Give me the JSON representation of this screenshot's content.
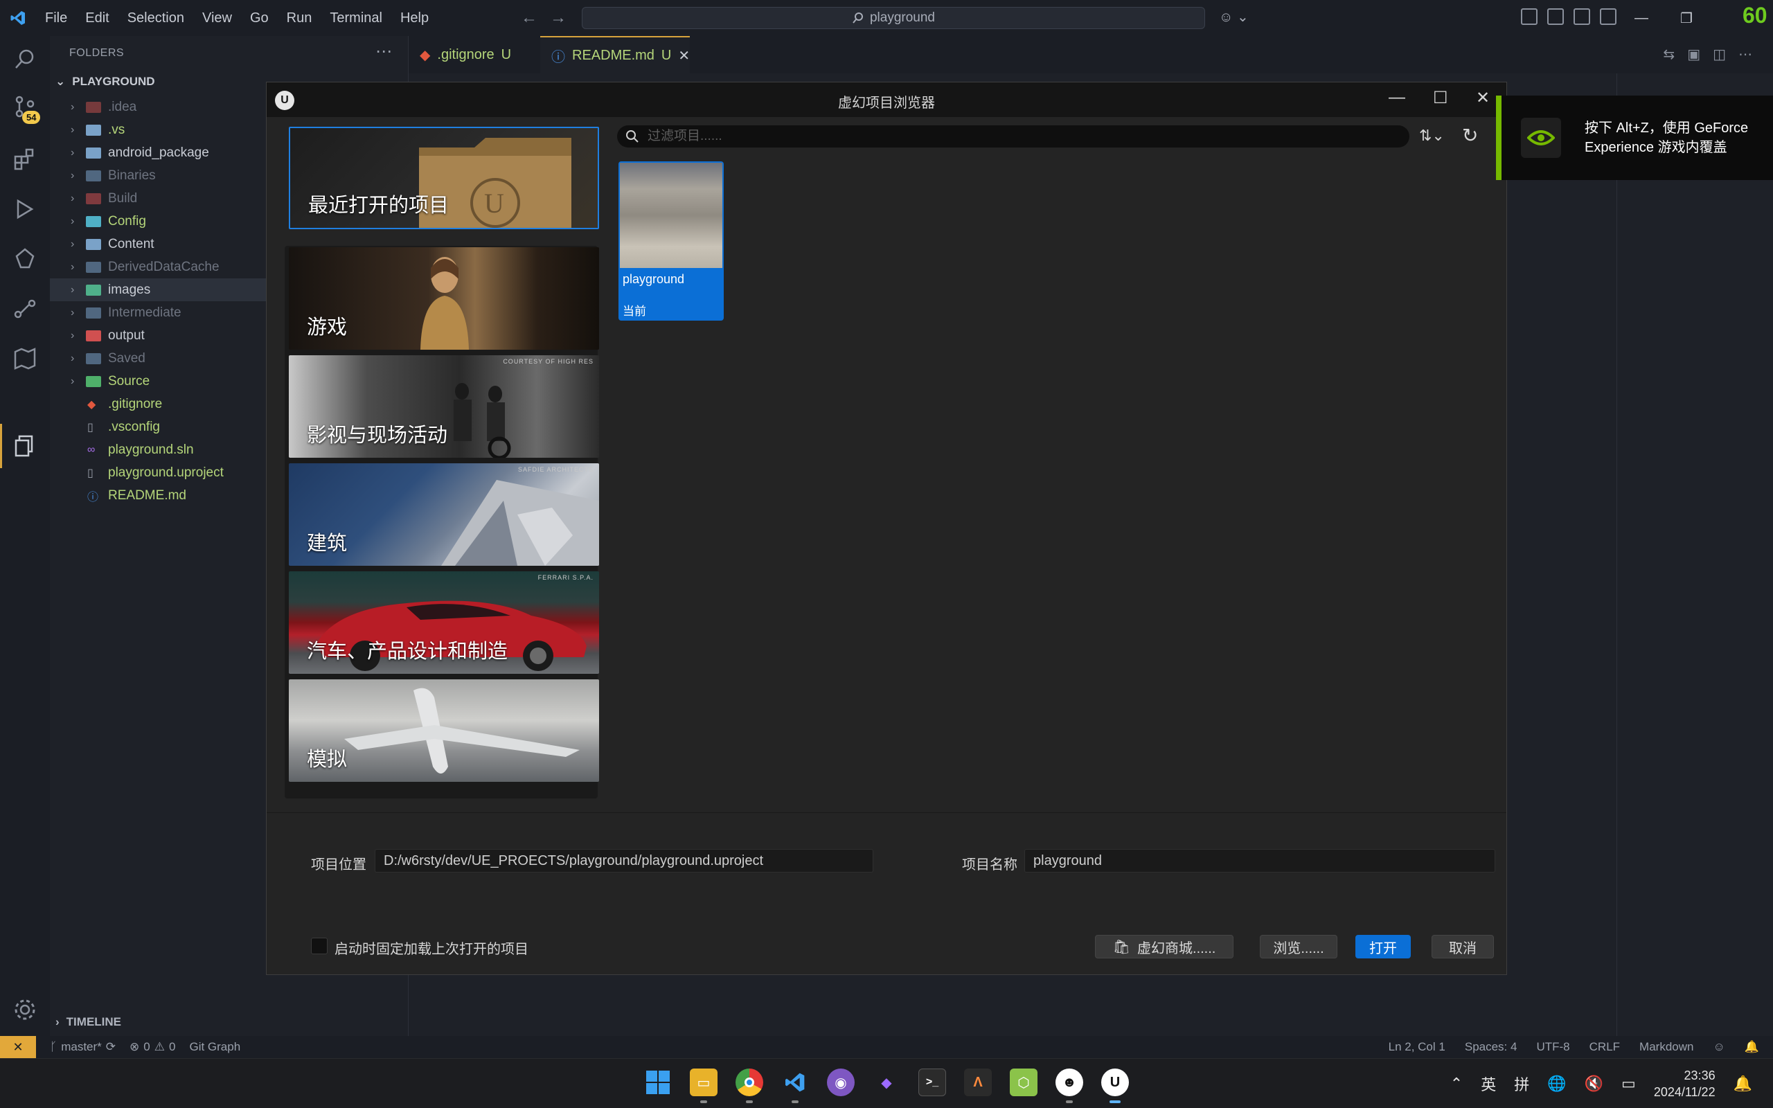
{
  "titlebar": {
    "menu": [
      "File",
      "Edit",
      "Selection",
      "View",
      "Go",
      "Run",
      "Terminal",
      "Help"
    ],
    "search_text": "playground",
    "fps": "60"
  },
  "activity": {
    "scm_badge": "54"
  },
  "sidebar": {
    "header": "FOLDERS",
    "root": "PLAYGROUND",
    "items": [
      {
        "label": ".idea",
        "type": "folder",
        "color": "#6e7480",
        "icon_color": "#c0504d",
        "muted": true
      },
      {
        "label": ".vs",
        "type": "folder",
        "color": "#b5d67a",
        "icon_color": "#7aa2c8",
        "muted": false
      },
      {
        "label": "android_package",
        "type": "folder",
        "color": "#c8ccd4",
        "icon_color": "#7aa2c8",
        "muted": false
      },
      {
        "label": "Binaries",
        "type": "folder",
        "color": "#6e7480",
        "icon_color": "#7aa2c8",
        "muted": true
      },
      {
        "label": "Build",
        "type": "folder",
        "color": "#6e7480",
        "icon_color": "#d05050",
        "muted": true
      },
      {
        "label": "Config",
        "type": "folder",
        "color": "#b5d67a",
        "icon_color": "#4fb0c6",
        "muted": false
      },
      {
        "label": "Content",
        "type": "folder",
        "color": "#c8ccd4",
        "icon_color": "#7aa2c8",
        "muted": false
      },
      {
        "label": "DerivedDataCache",
        "type": "folder",
        "color": "#6e7480",
        "icon_color": "#7aa2c8",
        "muted": true
      },
      {
        "label": "images",
        "type": "folder",
        "color": "#c8ccd4",
        "icon_color": "#4fb08a",
        "muted": false
      },
      {
        "label": "Intermediate",
        "type": "folder",
        "color": "#6e7480",
        "icon_color": "#7aa2c8",
        "muted": true
      },
      {
        "label": "output",
        "type": "folder",
        "color": "#c8ccd4",
        "icon_color": "#d05050",
        "muted": false
      },
      {
        "label": "Saved",
        "type": "folder",
        "color": "#6e7480",
        "icon_color": "#7aa2c8",
        "muted": true
      },
      {
        "label": "Source",
        "type": "folder",
        "color": "#b5d67a",
        "icon_color": "#4fb06a",
        "muted": false
      },
      {
        "label": ".gitignore",
        "type": "file",
        "color": "#b5d67a",
        "icon_color": "#e2583e",
        "glyph": "◆"
      },
      {
        "label": ".vsconfig",
        "type": "file",
        "color": "#b5d67a",
        "icon_color": "#9aa0ab",
        "glyph": "▯"
      },
      {
        "label": "playground.sln",
        "type": "file",
        "color": "#b5d67a",
        "icon_color": "#a66ee8",
        "glyph": "∞"
      },
      {
        "label": "playground.uproject",
        "type": "file",
        "color": "#b5d67a",
        "icon_color": "#9aa0ab",
        "glyph": "▯"
      },
      {
        "label": "README.md",
        "type": "file",
        "color": "#b5d67a",
        "icon_color": "#4a90e2",
        "glyph": "ⓘ"
      }
    ],
    "timeline": "TIMELINE"
  },
  "tabs": [
    {
      "label": ".gitignore",
      "status": "U",
      "icon_color": "#e2583e"
    },
    {
      "label": "README.md",
      "status": "U",
      "icon_color": "#4a90e2"
    }
  ],
  "statusbar": {
    "branch": "master*",
    "problems": "0",
    "warnings": "0",
    "git_graph": "Git Graph",
    "position": "Ln 2, Col 1",
    "spaces": "Spaces: 4",
    "encoding": "UTF-8",
    "eol": "CRLF",
    "language": "Markdown"
  },
  "ue": {
    "title": "虚幻项目浏览器",
    "search_placeholder": "过滤项目......",
    "categories": {
      "recent": "最近打开的项目",
      "games": "游戏",
      "film": "影视与现场活动",
      "arch": "建筑",
      "auto": "汽车、产品设计和制造",
      "sim": "模拟"
    },
    "watermarks": {
      "film": "COURTESY OF HIGH RES",
      "arch": "SAFDIE ARCHITECTS",
      "auto": "FERRARI S.P.A."
    },
    "project": {
      "name": "playground",
      "status": "当前"
    },
    "location_label": "项目位置",
    "location_value": "D:/w6rsty/dev/UE_PROECTS/playground/playground.uproject",
    "name_label": "项目名称",
    "name_value": "playground",
    "startup_label": "启动时固定加载上次打开的项目",
    "buttons": {
      "marketplace": "虚幻商城......",
      "browse": "浏览......",
      "open": "打开",
      "cancel": "取消"
    }
  },
  "nvidia": {
    "message": "按下 Alt+Z，使用 GeForce Experience 游戏内覆盖"
  },
  "taskbar": {
    "ime_lang": "英",
    "ime_mode": "拼",
    "time": "23:36",
    "date": "2024/11/22"
  }
}
